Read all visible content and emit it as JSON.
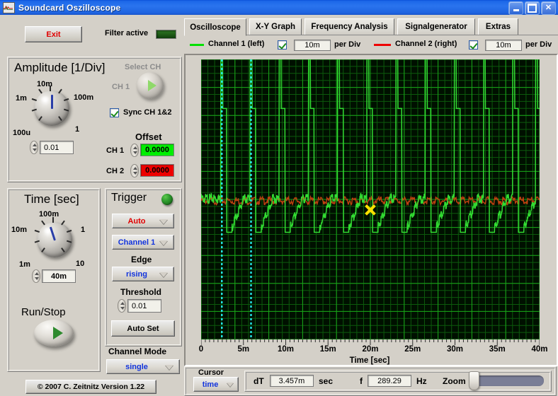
{
  "window": {
    "title": "Soundcard Oszilloscope",
    "icon": "oscilloscope-icon",
    "minimize": "_",
    "maximize": "□",
    "close": "×"
  },
  "toolbar": {
    "exit_label": "Exit",
    "filter_label": "Filter active",
    "filter_led_color": "#1d5c12"
  },
  "tabs": [
    {
      "label": "Oscilloscope",
      "active": true
    },
    {
      "label": "X-Y Graph",
      "active": false
    },
    {
      "label": "Frequency Analysis",
      "active": false
    },
    {
      "label": "Signalgenerator",
      "active": false
    },
    {
      "label": "Extras",
      "active": false
    }
  ],
  "channels": {
    "ch1": {
      "label": "Channel 1 (left)",
      "color": "#00e000",
      "checked": true,
      "per_div_value": "10m",
      "per_div_label": "per Div"
    },
    "ch2": {
      "label": "Channel 2 (right)",
      "color": "#ee0000",
      "checked": true,
      "per_div_value": "10m",
      "per_div_label": "per Div"
    }
  },
  "amplitude": {
    "title": "Amplitude [1/Div]",
    "knob_labels": [
      "100u",
      "1m",
      "10m",
      "100m",
      "1"
    ],
    "value": "0.01",
    "select_ch_label": "Select CH",
    "ch_selector_label": "CH 1",
    "sync_label": "Sync CH 1&2",
    "sync_checked": true,
    "offset_title": "Offset",
    "offset_ch1_label": "CH 1",
    "offset_ch1_value": "0.0000",
    "offset_ch1_color": "#00ee00",
    "offset_ch2_label": "CH 2",
    "offset_ch2_value": "0.0000",
    "offset_ch2_color": "#ee0000"
  },
  "time": {
    "title": "Time [sec]",
    "knob_labels": [
      "1m",
      "10m",
      "100m",
      "1",
      "10"
    ],
    "value": "40m"
  },
  "runstop": {
    "label": "Run/Stop"
  },
  "trigger": {
    "title": "Trigger",
    "led_color": "#1f8a1f",
    "mode_value": "Auto",
    "mode_color": "#e00000",
    "source_value": "Channel 1",
    "source_color": "#1133dd",
    "edge_label": "Edge",
    "edge_value": "rising",
    "edge_color": "#1133dd",
    "threshold_label": "Threshold",
    "threshold_value": "0.01",
    "autoset_label": "Auto Set"
  },
  "channel_mode": {
    "label": "Channel Mode",
    "value": "single",
    "value_color": "#1133dd"
  },
  "copyright": "© 2007   C. Zeitnitz Version 1.22",
  "cursor_bar": {
    "cursor_label": "Cursor",
    "cursor_mode": "time",
    "cursor_mode_color": "#1133dd",
    "dt_label": "dT",
    "dt_value": "3.457m",
    "dt_unit": "sec",
    "f_label": "f",
    "f_value": "289.29",
    "f_unit": "Hz",
    "zoom_label": "Zoom",
    "zoom_percent": 2
  },
  "chart_data": {
    "type": "line",
    "title": "",
    "xlabel": "Time [sec]",
    "ylabel": "",
    "xlim": [
      0,
      0.04
    ],
    "xticks": [
      "0",
      "5m",
      "10m",
      "15m",
      "20m",
      "25m",
      "30m",
      "35m",
      "40m"
    ],
    "xtick_values": [
      0,
      0.005,
      0.01,
      0.015,
      0.02,
      0.025,
      0.03,
      0.035,
      0.04
    ],
    "grid": true,
    "grid_major_color": "#19a319",
    "grid_minor_color": "#0c5a0c",
    "background": "#001000",
    "legend_position": "top",
    "series": [
      {
        "name": "Channel 1 (left)",
        "color": "#32dc32",
        "description": "Pulse train, ~289 Hz, sharp positive spikes with decaying tail and small undershoot",
        "baseline": 0.0,
        "peak": 0.052,
        "undershoot": -0.012,
        "pulse_times": [
          0.00245,
          0.0059,
          0.00935,
          0.0128,
          0.01625,
          0.0197,
          0.02315,
          0.0266,
          0.03005,
          0.0335,
          0.03695,
          0.03965
        ]
      },
      {
        "name": "Channel 2 (right)",
        "color": "#c04010",
        "description": "Near-zero noisy baseline overlapping Channel 1",
        "baseline": 0.0
      }
    ],
    "cursors": [
      {
        "name": "cursor-1",
        "x": 0.00245,
        "color": "#22e8e8",
        "style": "dotted-vertical"
      },
      {
        "name": "cursor-2",
        "x": 0.0059,
        "color": "#22e8e8",
        "style": "dotted-vertical"
      }
    ],
    "marker": {
      "name": "data-marker",
      "x": 0.02,
      "y": -0.004,
      "color": "#ffe000",
      "shape": "cross"
    }
  }
}
